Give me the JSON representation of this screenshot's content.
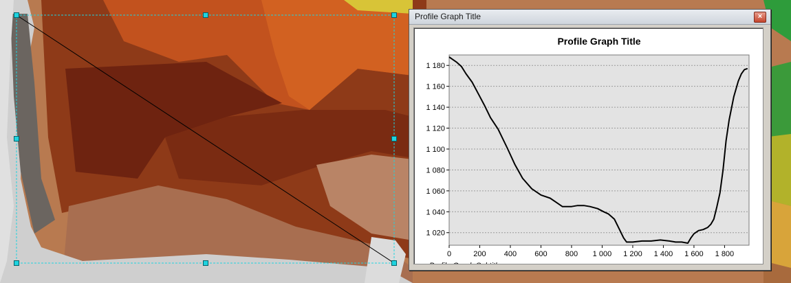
{
  "window": {
    "title": "Profile Graph Title",
    "close_icon": "close-icon"
  },
  "colors": {
    "selection": "#1fd3df",
    "plot_background": "#e3e3e3",
    "profile_line": "#000000",
    "close_button": "#c5452c"
  },
  "chart_data": {
    "type": "line",
    "title": "Profile Graph Title",
    "subtitle": "Profile Graph Subtitle",
    "xlabel": "",
    "ylabel": "",
    "xlim": [
      0,
      1960
    ],
    "ylim": [
      1008,
      1190
    ],
    "grid": "horizontal",
    "xticks": [
      0,
      200,
      400,
      600,
      800,
      1000,
      1200,
      1400,
      1600,
      1800
    ],
    "xtick_labels": [
      "0",
      "200",
      "400",
      "600",
      "800",
      "1 000",
      "1 200",
      "1 400",
      "1 600",
      "1 800"
    ],
    "yticks": [
      1020,
      1040,
      1060,
      1080,
      1100,
      1120,
      1140,
      1160,
      1180
    ],
    "ytick_labels": [
      "1 020",
      "1 040",
      "1 060",
      "1 080",
      "1 100",
      "1 120",
      "1 140",
      "1 160",
      "1 180"
    ],
    "series": [
      {
        "x": [
          0,
          20,
          50,
          80,
          110,
          150,
          190,
          230,
          270,
          320,
          380,
          430,
          480,
          540,
          600,
          660,
          700,
          740,
          800,
          840,
          880,
          920,
          970,
          1010,
          1040,
          1080,
          1110,
          1140,
          1160,
          1200,
          1260,
          1320,
          1380,
          1440,
          1480,
          1520,
          1560,
          1580,
          1600,
          1630,
          1660,
          1690,
          1710,
          1730,
          1750,
          1770,
          1790,
          1810,
          1830,
          1860,
          1890,
          1910,
          1930,
          1950
        ],
        "y": [
          1188,
          1186,
          1183,
          1179,
          1172,
          1164,
          1153,
          1142,
          1130,
          1119,
          1101,
          1085,
          1072,
          1062,
          1056,
          1053,
          1049,
          1045,
          1045,
          1046,
          1046,
          1045,
          1043,
          1040,
          1038,
          1033,
          1024,
          1015,
          1011,
          1011,
          1012,
          1012,
          1013,
          1012,
          1011,
          1011,
          1010,
          1015,
          1019,
          1022,
          1023,
          1025,
          1028,
          1033,
          1045,
          1058,
          1080,
          1108,
          1128,
          1150,
          1165,
          1172,
          1176,
          1177
        ]
      }
    ]
  }
}
